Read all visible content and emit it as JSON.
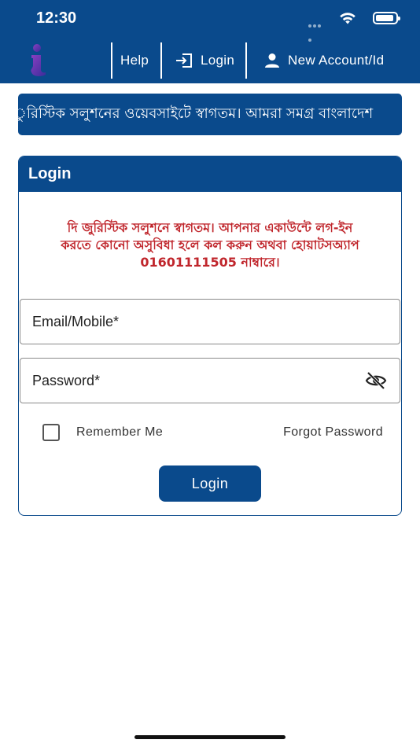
{
  "status_bar": {
    "time": "12:30"
  },
  "nav": {
    "help_label": "Help",
    "login_label": "Login",
    "new_account_label": "New Account/Id"
  },
  "marquee": {
    "text": "ুরিস্টিক সলুশনের ওয়েবসাইটে স্বাগতম। আমরা সমগ্র বাংলাদেশ"
  },
  "login_card": {
    "title": "Login",
    "welcome_line1": "দি জুরিস্টিক সলুশনে স্বাগতম। আপনার একাউন্টে লগ-ইন",
    "welcome_line2": "করতে কোনো অসুবিধা হলে কল করুন অথবা হোয়াটসঅ্যাপ",
    "welcome_line3": "01601111505 নাম্বারে।",
    "email_placeholder": "Email/Mobile*",
    "password_placeholder": "Password*",
    "remember_label": "Remember Me",
    "forgot_label": "Forgot Password",
    "submit_label": "Login"
  },
  "icons": {
    "logo": "brand-logo-icon",
    "login": "login-icon",
    "account": "person-icon",
    "visibility": "eye-off-icon"
  },
  "colors": {
    "primary": "#0a4a8c",
    "welcome_text": "#c0262c",
    "background": "#ffffff"
  }
}
